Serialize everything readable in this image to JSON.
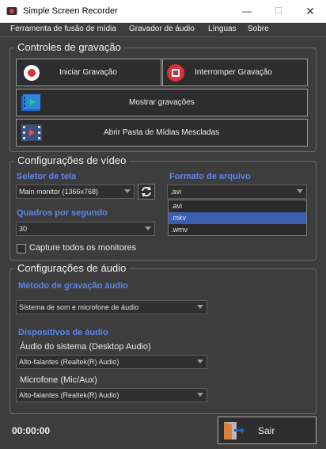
{
  "window": {
    "title": "Simple Screen Recorder"
  },
  "menu": [
    "Ferramenta de fusão de mídia",
    "Gravador de áudio",
    "Línguas",
    "Sobre"
  ],
  "recording_controls": {
    "title": "Controles de gravação",
    "start_label": "Iniciar Gravação",
    "stop_label": "Interromper Gravação",
    "show_recordings_label": "Mostrar gravações",
    "open_folder_label": "Abrir Pasta de Mídias Mescladas"
  },
  "video_settings": {
    "title": "Configurações de vídeo",
    "screen_selector_label": "Seletor de tela",
    "screen_selected": "Main monitor (1366x768)",
    "file_format_label": "Formato de arquivo",
    "file_format_selected": ".avi",
    "file_format_options": [
      ".avi",
      ".mkv",
      ".wmv"
    ],
    "file_format_highlighted": ".mkv",
    "fps_label": "Quadros por segundo",
    "fps_selected": "30",
    "capture_all_label": "Capture todos os monitores",
    "capture_all_checked": false
  },
  "audio_settings": {
    "title": "Configurações de áudio",
    "method_label": "Método de gravação áudio",
    "method_selected": "Sistema de som e microfone de áudio",
    "devices_label": "Dispositivos de áudio",
    "system_audio_label": "Áudio do sistema (Desktop Audio)",
    "system_audio_selected": "Alto-falantes (Realtek(R) Audio)",
    "mic_label": "Microfone (Mic/Aux)",
    "mic_selected": "Alto-falantes (Realtek(R) Audio)"
  },
  "footer": {
    "timer": "00:00:00",
    "exit_label": "Sair"
  },
  "colors": {
    "accent_blue": "#5a87e8",
    "record_red": "#d9303a",
    "highlight": "#3a5fb0"
  }
}
